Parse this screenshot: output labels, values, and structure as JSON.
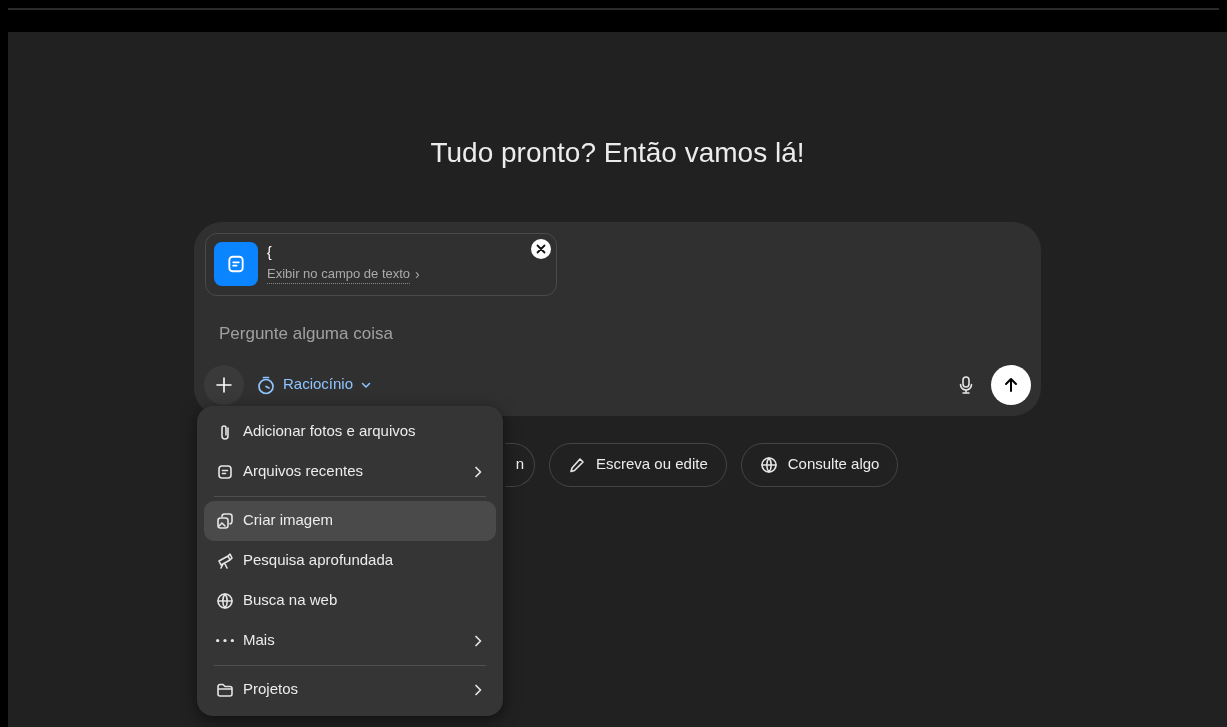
{
  "heading": "Tudo pronto? Então vamos lá!",
  "attachment": {
    "title": "{",
    "link": "Exibir no campo de texto",
    "chevron": "›"
  },
  "composer": {
    "placeholder": "Pergunte alguma coisa",
    "mode": "Raciocínio"
  },
  "menu": [
    {
      "kind": "item",
      "label": "Adicionar fotos e arquivos",
      "submenu": false,
      "selected": false
    },
    {
      "kind": "item",
      "label": "Arquivos recentes",
      "submenu": true,
      "selected": false
    },
    {
      "kind": "divider"
    },
    {
      "kind": "item",
      "label": "Criar imagem",
      "submenu": false,
      "selected": true
    },
    {
      "kind": "item",
      "label": "Pesquisa aprofundada",
      "submenu": false,
      "selected": false
    },
    {
      "kind": "item",
      "label": "Busca na web",
      "submenu": false,
      "selected": false
    },
    {
      "kind": "item",
      "label": "Mais",
      "submenu": true,
      "selected": false
    },
    {
      "kind": "divider"
    },
    {
      "kind": "item",
      "label": "Projetos",
      "submenu": true,
      "selected": false
    }
  ],
  "suggestions": [
    {
      "label": "n"
    },
    {
      "label": "Escreva ou edite"
    },
    {
      "label": "Consulte algo"
    }
  ]
}
